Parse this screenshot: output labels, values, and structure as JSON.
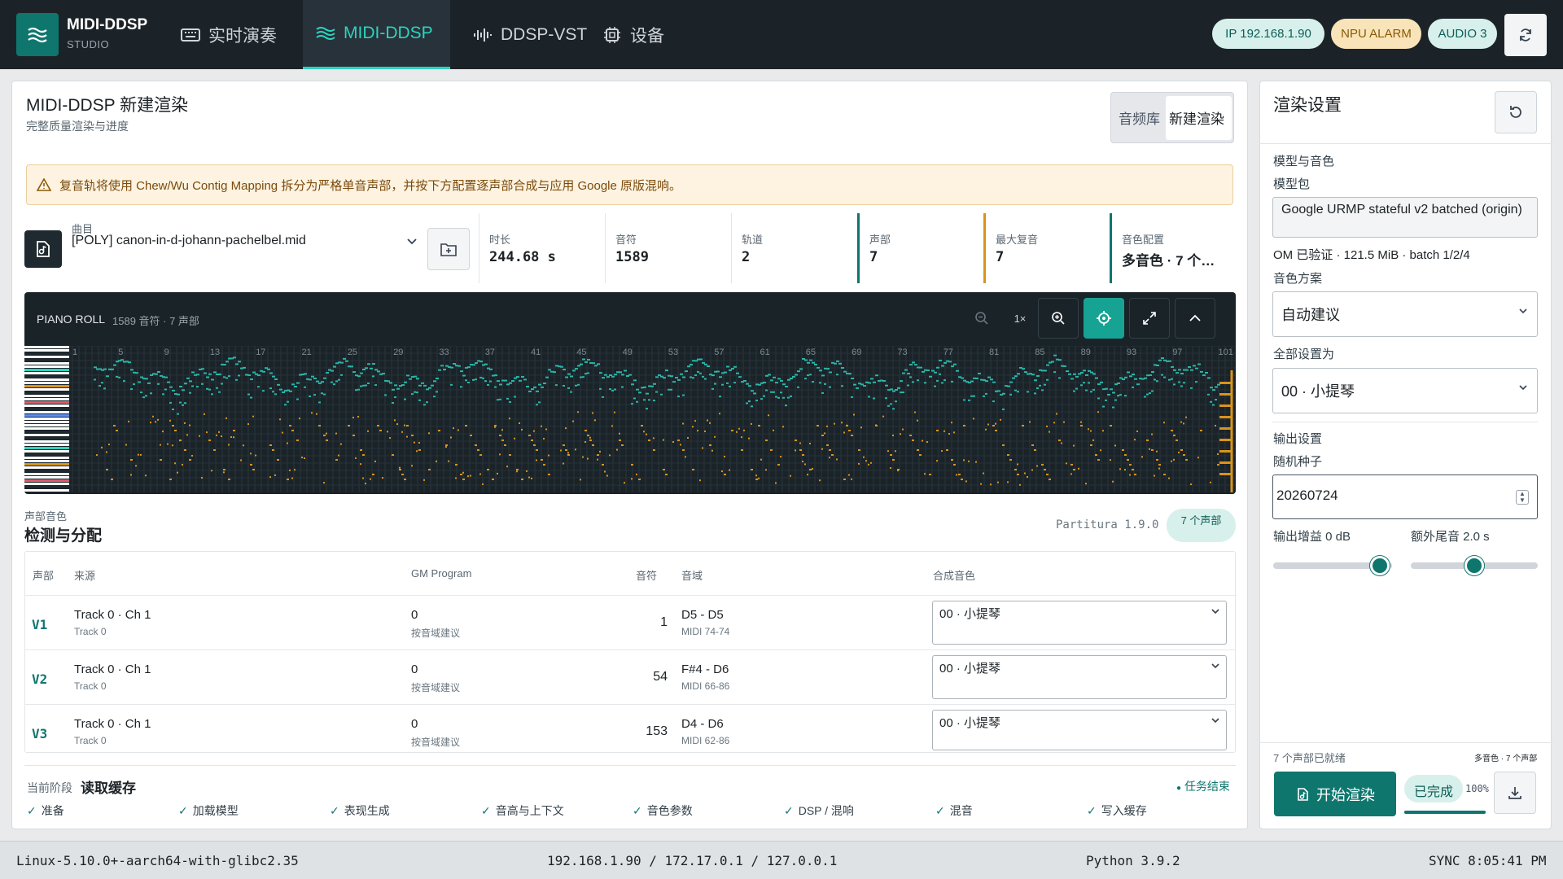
{
  "app": {
    "name": "MIDI-DDSP",
    "sub": "STUDIO"
  },
  "nav": [
    {
      "label": "实时演奏",
      "icon": "keyboard-icon"
    },
    {
      "label": "MIDI-DDSP",
      "icon": "waves-icon"
    },
    {
      "label": "DDSP-VST",
      "icon": "waveform-icon"
    },
    {
      "label": "设备",
      "icon": "cpu-icon"
    }
  ],
  "status": {
    "ip": "IP 192.168.1.90",
    "npu": "NPU ALARM",
    "audio": "AUDIO 3"
  },
  "colors": {
    "accent": "#0f766e",
    "teal_light": "#2dd4bf",
    "amber": "#d9941a"
  },
  "main": {
    "title": "MIDI-DDSP 新建渲染",
    "subtitle": "完整质量渲染与进度",
    "seg": {
      "library": "音频库",
      "new": "新建渲染"
    },
    "alert": "复音轨将使用 Chew/Wu Contig Mapping 拆分为严格单音声部，并按下方配置逐声部合成与应用 Google 原版混响。",
    "file": {
      "label": "曲目",
      "value": "[POLY] canon-in-d-johann-pachelbel.mid"
    },
    "stats": [
      {
        "label": "时长",
        "value": "244.68 s"
      },
      {
        "label": "音符",
        "value": "1589"
      },
      {
        "label": "轨道",
        "value": "2"
      },
      {
        "label": "声部",
        "value": "7"
      },
      {
        "label": "最大复音",
        "value": "7"
      },
      {
        "label": "音色配置",
        "value": "多音色 · 7 个…"
      }
    ],
    "roll": {
      "title": "PIANO ROLL",
      "info": "1589 音符 · 7 声部",
      "zoom": "1×",
      "bars": [
        "1",
        "5",
        "9",
        "13",
        "17",
        "21",
        "25",
        "29",
        "33",
        "37",
        "41",
        "45",
        "49",
        "53",
        "57",
        "61",
        "65",
        "69",
        "73",
        "77",
        "81",
        "85",
        "89",
        "93",
        "97",
        "101"
      ]
    },
    "voices": {
      "kicker": "声部音色",
      "heading": "检测与分配",
      "version": "Partitura 1.9.0",
      "badge": "7 个声部",
      "headers": [
        "声部",
        "来源",
        "GM Program",
        "音符",
        "音域",
        "合成音色"
      ],
      "rows": [
        {
          "voice": "V1",
          "source": "Track 0 · Ch 1",
          "track": "Track 0",
          "program": "0",
          "program_hint": "按音域建议",
          "notes": "1",
          "range": "D5 - D5",
          "midi": "MIDI 74-74",
          "timbre": "00 · 小提琴"
        },
        {
          "voice": "V2",
          "source": "Track 0 · Ch 1",
          "track": "Track 0",
          "program": "0",
          "program_hint": "按音域建议",
          "notes": "54",
          "range": "F#4 - D6",
          "midi": "MIDI 66-86",
          "timbre": "00 · 小提琴"
        },
        {
          "voice": "V3",
          "source": "Track 0 · Ch 1",
          "track": "Track 0",
          "program": "0",
          "program_hint": "按音域建议",
          "notes": "153",
          "range": "D4 - D6",
          "midi": "MIDI 62-86",
          "timbre": "00 · 小提琴"
        }
      ]
    },
    "stage": {
      "label": "当前阶段",
      "value": "读取缓存",
      "task": "任务结束",
      "steps": [
        "准备",
        "加载模型",
        "表现生成",
        "音高与上下文",
        "音色参数",
        "DSP / 混响",
        "混音",
        "写入缓存"
      ]
    }
  },
  "render": {
    "title": "渲染设置",
    "model_section": "模型与音色",
    "model_label": "模型包",
    "model_value": "Google URMP stateful v2 batched (origin)",
    "model_info": "OM 已验证 · 121.5 MiB · batch 1/2/4",
    "scheme_label": "音色方案",
    "scheme_value": "自动建议",
    "all_label": "全部设置为",
    "all_value": "00 · 小提琴",
    "output_section": "输出设置",
    "seed_label": "随机种子",
    "seed_value": "20260724",
    "gain_label": "输出增益 0 dB",
    "tail_label": "额外尾音 2.0 s",
    "gain_value": 0.9,
    "tail_value": 0.5,
    "ready": "7 个声部已就绪",
    "mode": "多音色 · 7 个声部",
    "start": "开始渲染",
    "done": "已完成",
    "percent": "100%",
    "progress": 1.0
  },
  "footer": {
    "platform": "Linux-5.10.0+-aarch64-with-glibc2.35",
    "ips": "192.168.1.90 / 172.17.0.1 / 127.0.0.1",
    "python": "Python 3.9.2",
    "sync": "SYNC 8:05:41 PM"
  }
}
